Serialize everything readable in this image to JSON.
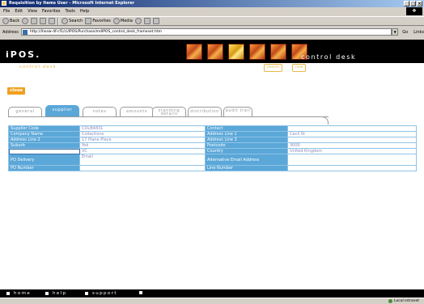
{
  "window": {
    "title": "Requisition by Items User - Microsoft Internet Explorer"
  },
  "browser": {
    "menus": [
      "File",
      "Edit",
      "View",
      "Favorites",
      "Tools",
      "Help"
    ],
    "toolbar": {
      "back": "Back",
      "search": "Search",
      "favorites": "Favorites",
      "media": "Media"
    },
    "address_label": "Address",
    "address_value": "http://ihosw-4f-cf1/ci/IPOS/Purchase/mdIPOS_control_desk_frameset.htm",
    "go": "Go",
    "links": "Links",
    "status_zone": "Local intranet"
  },
  "app": {
    "logo": "iPOS.",
    "product": "control desk",
    "section": "control desk",
    "header_buttons": [
      "search",
      "new"
    ],
    "close_label": "close",
    "tabs": [
      {
        "label": "general",
        "active": false
      },
      {
        "label": "supplier",
        "active": true
      },
      {
        "label": "notes",
        "active": false
      },
      {
        "label": "amounts",
        "active": false
      },
      {
        "label": "standing details",
        "active": false
      },
      {
        "label": "distribution",
        "active": false
      },
      {
        "label": "audit trail",
        "active": false
      }
    ],
    "form": {
      "rows": [
        {
          "l1": "Supplier Code",
          "v1": "COLB4831",
          "l2": "Contact",
          "v2": ""
        },
        {
          "l1": "Company Name",
          "v1": "Collections",
          "l2": "Address Line 1",
          "v2": "Cecil St"
        },
        {
          "l1": "Address Line 2",
          "v1": "17 Plane Place",
          "l2": "Address Line 3",
          "v2": ""
        },
        {
          "l1": "Suburb",
          "v1": "Yok",
          "l2": "Postcode",
          "v2": "3000"
        },
        {
          "l1": "",
          "v1": "VC",
          "l2": "Country",
          "v2": "United Kingdom"
        },
        {
          "l1": "PO Delivery",
          "v1": "Email",
          "l2": "Alternative Email Address",
          "v2": ""
        },
        {
          "l1": "PO Number",
          "v1": "",
          "l2": "Line Number",
          "v2": ""
        }
      ]
    },
    "footer": [
      "home",
      "help",
      "support"
    ]
  }
}
